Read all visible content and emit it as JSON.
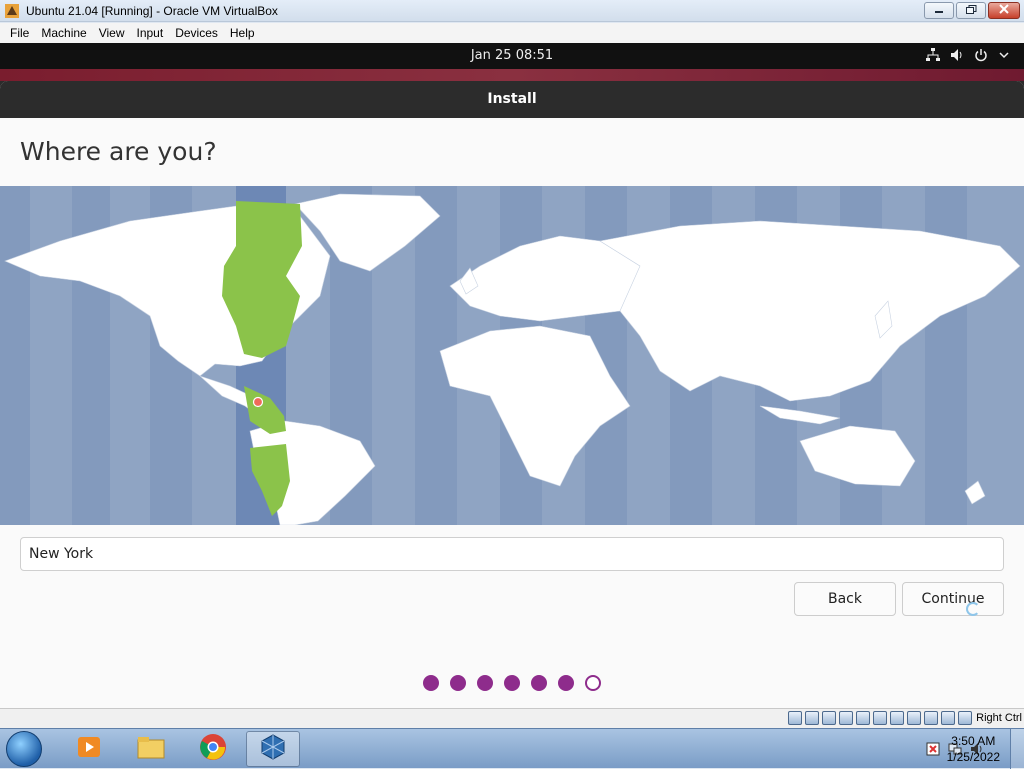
{
  "window": {
    "title": "Ubuntu 21.04 [Running] - Oracle VM VirtualBox",
    "minimize_icon": "minimize-icon",
    "restore_icon": "restore-icon",
    "close_icon": "close-icon"
  },
  "menubar": {
    "items": [
      "File",
      "Machine",
      "View",
      "Input",
      "Devices",
      "Help"
    ]
  },
  "gnome_bar": {
    "clock": "Jan 25  08:51",
    "tray_icons": [
      "network-icon",
      "volume-icon",
      "power-icon",
      "chevron-down-icon"
    ]
  },
  "installer": {
    "header_title": "Install",
    "heading": "Where are you?",
    "location_value": "New York",
    "back_label": "Back",
    "continue_label": "Continue",
    "progress": {
      "total_steps": 7,
      "completed_steps": 6
    },
    "colors": {
      "accent": "#8e2c8c",
      "map_ocean": "#8fa4c3",
      "timezone_highlight": "#8bc34a"
    }
  },
  "vb_status": {
    "host_key": "Right Ctrl"
  },
  "taskbar": {
    "apps": [
      "windows-media-player-icon",
      "windows-explorer-icon",
      "chrome-icon",
      "virtualbox-icon"
    ],
    "clock_time": "3:50 AM",
    "clock_date": "1/25/2022"
  }
}
